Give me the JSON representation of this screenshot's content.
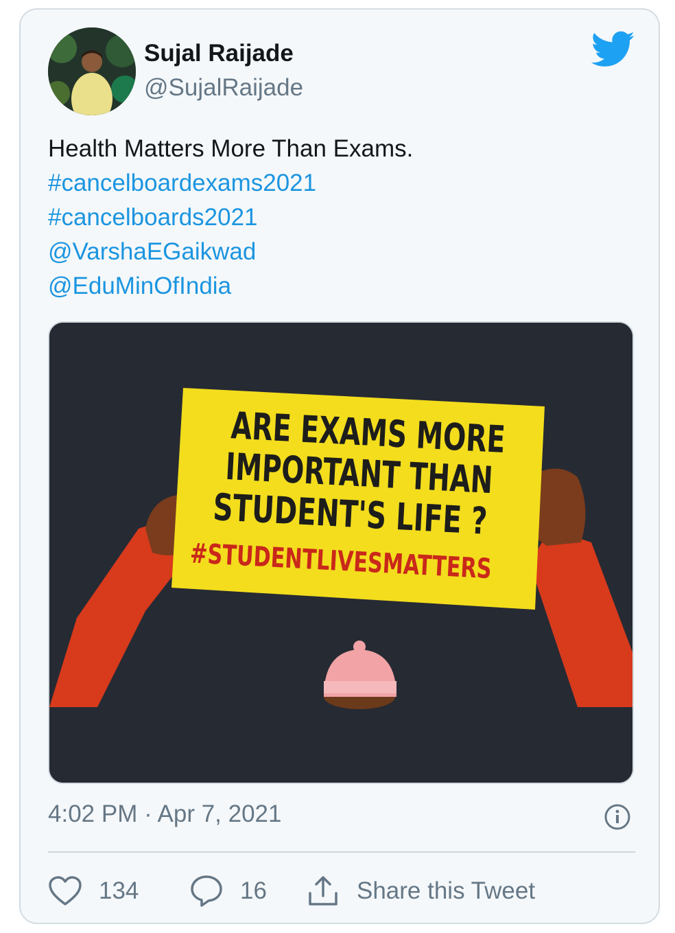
{
  "author": {
    "name": "Sujal Raijade",
    "handle": "@SujalRaijade"
  },
  "tweet": {
    "text": "Health Matters More Than Exams.",
    "links": [
      "#cancelboardexams2021",
      "#cancelboards2021",
      "@VarshaEGaikwad",
      "@EduMinOfIndia"
    ]
  },
  "media": {
    "sign_lines": [
      "ARE EXAMS MORE",
      "IMPORTANT THAN",
      "STUDENT'S LIFE ?"
    ],
    "sign_hashtag": "#STUDENTLIVESMATTERS"
  },
  "meta": {
    "timestamp": "4:02 PM · Apr 7, 2021"
  },
  "actions": {
    "likes": "134",
    "replies": "16",
    "share_label": "Share this Tweet"
  },
  "colors": {
    "link": "#1b95e0",
    "brand": "#1da1f2",
    "sign_yellow": "#f3dd1d",
    "sign_hashtag": "#c9281a"
  },
  "icons": [
    "twitter-bird-icon",
    "info-icon",
    "heart-icon",
    "reply-bubble-icon",
    "share-icon"
  ]
}
